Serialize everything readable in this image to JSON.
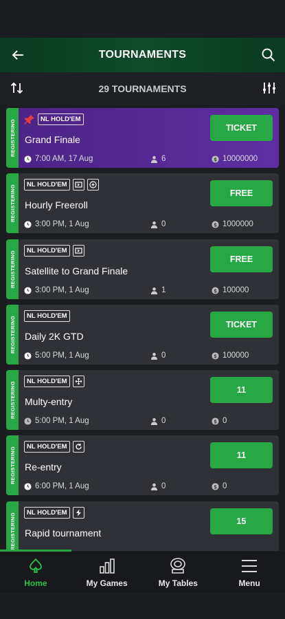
{
  "header": {
    "title": "TOURNAMENTS"
  },
  "subbar": {
    "count_label": "29 TOURNAMENTS"
  },
  "tournaments": [
    {
      "status": "REGISTERING",
      "game": "NL HOLD'EM",
      "name": "Grand Finale",
      "time": "7:00 AM, 17 Aug",
      "players": "6",
      "prize": "10000000",
      "action": "TICKET"
    },
    {
      "status": "REGISTERING",
      "game": "NL HOLD'EM",
      "name": "Hourly Freeroll",
      "time": "3:00 PM, 1 Aug",
      "players": "0",
      "prize": "1000000",
      "action": "FREE"
    },
    {
      "status": "REGISTERING",
      "game": "NL HOLD'EM",
      "name": "Satellite to Grand Finale",
      "time": "3:00 PM, 1 Aug",
      "players": "1",
      "prize": "100000",
      "action": "FREE"
    },
    {
      "status": "REGISTERING",
      "game": "NL HOLD'EM",
      "name": "Daily 2K GTD",
      "time": "5:00 PM, 1 Aug",
      "players": "0",
      "prize": "100000",
      "action": "TICKET"
    },
    {
      "status": "REGISTERING",
      "game": "NL HOLD'EM",
      "name": "Multy-entry",
      "time": "5:00 PM, 1 Aug",
      "players": "0",
      "prize": "0",
      "action": "11"
    },
    {
      "status": "REGISTERING",
      "game": "NL HOLD'EM",
      "name": "Re-entry",
      "time": "6:00 PM, 1 Aug",
      "players": "0",
      "prize": "0",
      "action": "11"
    },
    {
      "status": "REGISTERING",
      "game": "NL HOLD'EM",
      "name": "Rapid tournament",
      "time": "",
      "players": "",
      "prize": "",
      "action": "15"
    }
  ],
  "nav": [
    {
      "label": "Home",
      "icon": "spade-icon"
    },
    {
      "label": "My Games",
      "icon": "bar-chart-icon"
    },
    {
      "label": "My Tables",
      "icon": "poker-chip-icon"
    },
    {
      "label": "Menu",
      "icon": "menu-icon"
    }
  ],
  "colors": {
    "accent": "#27a844",
    "featured": "#5a2c99",
    "card": "#2f3136",
    "header": "#0f4a2a"
  }
}
